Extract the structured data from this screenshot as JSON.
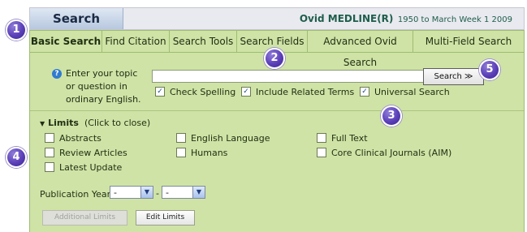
{
  "header": {
    "search_tab": "Search",
    "db_name": "Ovid MEDLINE(R)",
    "db_range": "1950 to March Week 1 2009"
  },
  "tabs": [
    {
      "label": "Basic Search",
      "active": true
    },
    {
      "label": "Find Citation"
    },
    {
      "label": "Search Tools"
    },
    {
      "label": "Search Fields"
    },
    {
      "label": "Advanced Ovid Search"
    },
    {
      "label": "Multi-Field Search"
    }
  ],
  "basic": {
    "prompt_line1": "Enter your topic",
    "prompt_line2": "or question in",
    "prompt_line3": "ordinary English.",
    "query_value": "",
    "search_button": "Search ≫",
    "options": [
      {
        "label": "Check Spelling",
        "checked": true
      },
      {
        "label": "Include Related Terms",
        "checked": true
      },
      {
        "label": "Universal Search",
        "checked": true
      }
    ]
  },
  "limits": {
    "title": "Limits",
    "toggle_hint": "(Click to close)",
    "items": [
      {
        "label": "Abstracts",
        "checked": false
      },
      {
        "label": "English Language",
        "checked": false
      },
      {
        "label": "Full Text",
        "checked": false
      },
      {
        "label": "Review Articles",
        "checked": false
      },
      {
        "label": "Humans",
        "checked": false
      },
      {
        "label": "Core Clinical Journals (AIM)",
        "checked": false
      },
      {
        "label": "Latest Update",
        "checked": false
      }
    ],
    "publication_year_label": "Publication Year",
    "year_from": "-",
    "year_to": "-",
    "separator": "-",
    "additional_limits_button": "Additional Limits",
    "edit_limits_button": "Edit Limits"
  },
  "callouts": [
    "1",
    "2",
    "3",
    "4",
    "5"
  ],
  "colors": {
    "panel_bg": "#cfe3a6",
    "panel_border": "#9dbd70",
    "callout": "#5b3fb8",
    "db_title": "#1d5e4a"
  }
}
